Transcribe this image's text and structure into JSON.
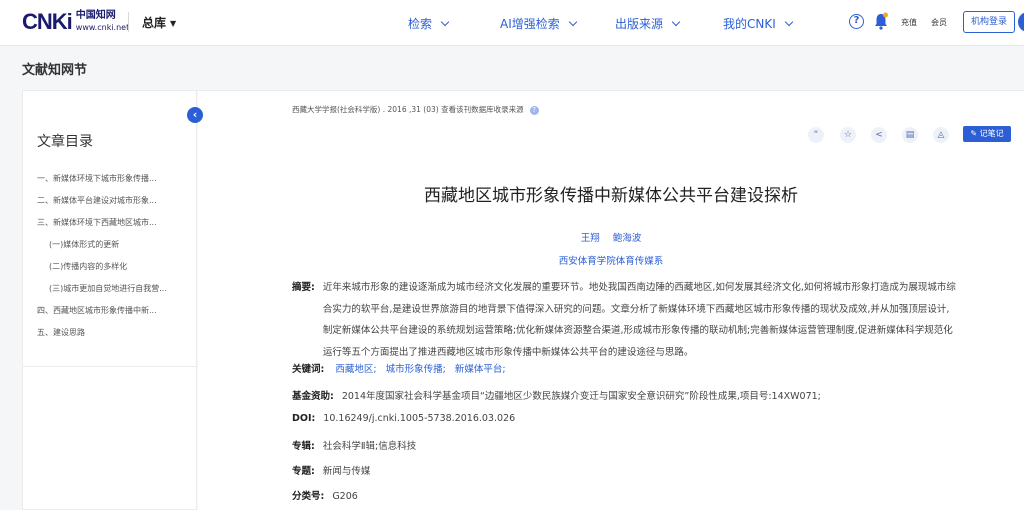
{
  "header": {
    "logo_mark": "CNKi",
    "logo_cn": "中国知网",
    "logo_url": "www.cnki.net",
    "library_label": "总库",
    "nav": [
      "检索",
      "AI增强检索",
      "出版来源",
      "我的CNKI"
    ],
    "recharge": "充值",
    "member": "会员",
    "org_login": "机构登录"
  },
  "section_title": "文献知网节",
  "sidebar": {
    "collapse_glyph": "‹",
    "toc_title": "文章目录",
    "items": [
      {
        "label": "一、新媒体环境下城市形象传播...",
        "sub": false
      },
      {
        "label": "二、新媒体平台建设对城市形象...",
        "sub": false
      },
      {
        "label": "三、新媒体环境下西藏地区城市...",
        "sub": false
      },
      {
        "label": "(一)媒体形式的更新",
        "sub": true
      },
      {
        "label": "(二)传播内容的多样化",
        "sub": true
      },
      {
        "label": "(三)城市更加自觉地进行自我营...",
        "sub": true
      },
      {
        "label": "四、西藏地区城市形象传播中新...",
        "sub": false
      },
      {
        "label": "五、建设思路",
        "sub": false
      }
    ]
  },
  "article": {
    "source": "西藏大学学报(社会科学版) . 2016 ,31 (03)  查看该刊数据库收录来源",
    "tools": [
      "quote-icon",
      "star-icon",
      "share-icon",
      "print-icon",
      "bell-icon"
    ],
    "note_button": "记笔记",
    "title": "西藏地区城市形象传播中新媒体公共平台建设探析",
    "authors": [
      "王翔",
      "鲍海波"
    ],
    "affiliation": "西安体育学院体育传媒系",
    "abstract_label": "摘要:",
    "abstract_lines": [
      "近年来城市形象的建设逐渐成为城市经济文化发展的重要环节。地处我国西南边陲的西藏地区,如何发展其经济文化,如何将城市形象打造成为展现城市综",
      "合实力的软平台,是建设世界旅游目的地背景下值得深入研究的问题。文章分析了新媒体环境下西藏地区城市形象传播的现状及成效,并从加强顶层设计,",
      "制定新媒体公共平台建设的系统规划运营策略;优化新媒体资源整合渠道,形成城市形象传播的联动机制;完善新媒体运营管理制度,促进新媒体科学规范化",
      "运行等五个方面提出了推进西藏地区城市形象传播中新媒体公共平台的建设途径与思路。"
    ],
    "keywords_label": "关键词:",
    "keywords": [
      "西藏地区;",
      "城市形象传播;",
      "新媒体平台;"
    ],
    "fund_label": "基金资助:",
    "fund": "2014年度国家社会科学基金项目“边疆地区少数民族媒介变迁与国家安全意识研究”阶段性成果,项目号:14XW071;",
    "doi_label": "DOI:",
    "doi": "10.16249/j.cnki.1005-5738.2016.03.026",
    "series_label": "专辑:",
    "series": "社会科学Ⅱ辑;信息科技",
    "topic_label": "专题:",
    "topic": "新闻与传媒",
    "class_label": "分类号:",
    "class_no": "G206"
  }
}
